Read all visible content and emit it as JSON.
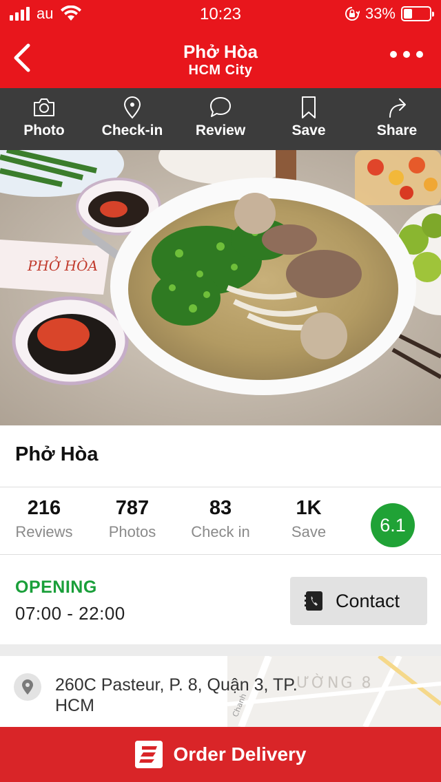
{
  "status_bar": {
    "carrier": "au",
    "time": "10:23",
    "battery_percent": "33%",
    "battery_level": 0.33
  },
  "nav": {
    "title": "Phở Hòa",
    "subtitle": "HCM City",
    "back_icon": "chevron-left-icon",
    "more_icon": "more-horizontal-icon"
  },
  "actions": [
    {
      "label": "Photo",
      "icon": "camera-icon"
    },
    {
      "label": "Check-in",
      "icon": "location-pin-icon"
    },
    {
      "label": "Review",
      "icon": "chat-bubble-icon"
    },
    {
      "label": "Save",
      "icon": "bookmark-icon"
    },
    {
      "label": "Share",
      "icon": "share-arrow-icon"
    }
  ],
  "place": {
    "name": "Phở Hòa"
  },
  "stats": [
    {
      "value": "216",
      "label": "Reviews"
    },
    {
      "value": "787",
      "label": "Photos"
    },
    {
      "value": "83",
      "label": "Check in"
    },
    {
      "value": "1K",
      "label": "Save"
    }
  ],
  "score": "6.1",
  "hours": {
    "status": "OPENING",
    "time": "07:00 - 22:00"
  },
  "contact": {
    "label": "Contact",
    "icon": "phone-book-icon"
  },
  "address": {
    "text": "260C Pasteur, P. 8, Quận 3, TP. HCM",
    "map_label": "ƯỜNG 8"
  },
  "order": {
    "label": "Order Delivery",
    "icon": "delivery-logo-icon"
  },
  "colors": {
    "brand_red": "#e8161c",
    "action_bar": "#3c3c3c",
    "score_green": "#20a236",
    "opening_green": "#1a9f3a",
    "order_red": "#d92528"
  }
}
